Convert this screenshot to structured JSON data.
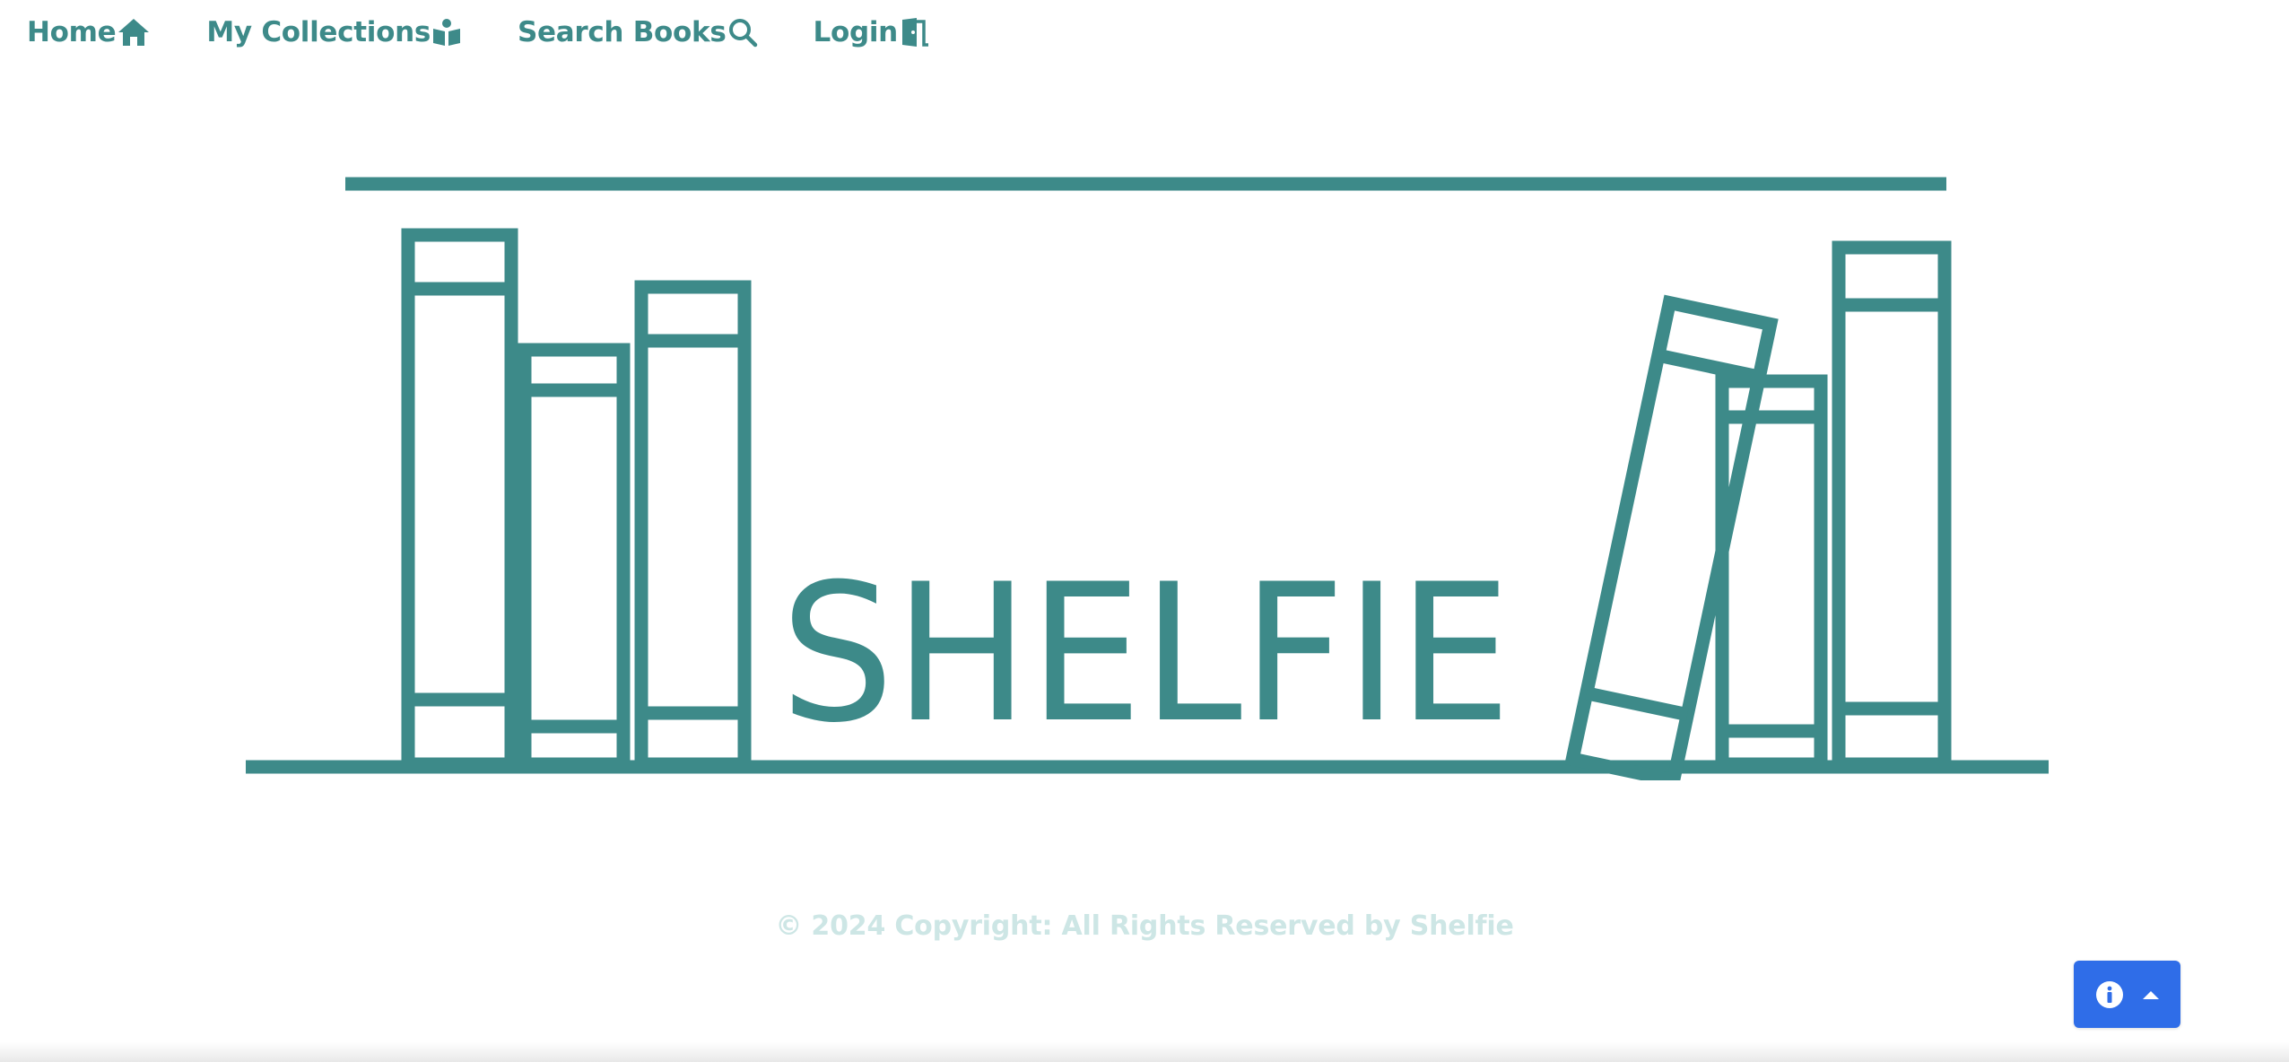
{
  "nav": {
    "items": [
      {
        "label": "Home",
        "icon": "home-icon"
      },
      {
        "label": "My Collections",
        "icon": "reading-person-icon"
      },
      {
        "label": "Search Books",
        "icon": "search-icon"
      },
      {
        "label": "Login",
        "icon": "door-open-icon"
      }
    ]
  },
  "logo": {
    "wordmark": "SHELFIE"
  },
  "footer": {
    "copyright": "© 2024 Copyright: All Rights Reserved by Shelfie"
  },
  "floating_button": {
    "icons": [
      "info-circle-icon",
      "caret-up-icon"
    ]
  },
  "colors": {
    "brand_teal": "#3d8a89",
    "footer_text": "#cde6e5",
    "info_button_bg": "#2f6de8",
    "background": "#ffffff"
  }
}
